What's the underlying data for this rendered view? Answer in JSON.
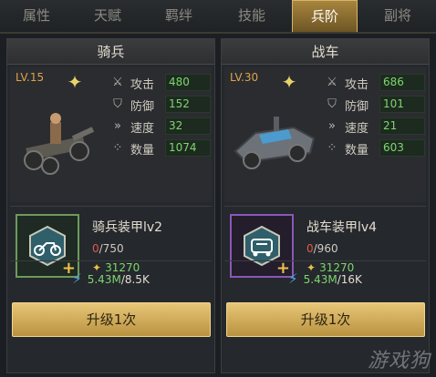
{
  "tabs": [
    "属性",
    "天赋",
    "羁绊",
    "技能",
    "兵阶",
    "副将"
  ],
  "active_tab": "兵阶",
  "panels": [
    {
      "title": "骑兵",
      "level": "LV.15",
      "stats": [
        {
          "label": "攻击",
          "value": "480",
          "icon": "swords-icon"
        },
        {
          "label": "防御",
          "value": "152",
          "icon": "shield-icon"
        },
        {
          "label": "速度",
          "value": "32",
          "icon": "speed-icon"
        },
        {
          "label": "数量",
          "value": "1074",
          "icon": "troops-icon"
        }
      ],
      "armor": {
        "name": "骑兵装甲lv2",
        "current": "0",
        "total": "/750",
        "cost": "31270",
        "frame_color": "green",
        "icon": "motorcycle-icon"
      },
      "power": {
        "have": "5.43M",
        "need": "/8.5K"
      },
      "button": "升级1次"
    },
    {
      "title": "战车",
      "level": "LV.30",
      "stats": [
        {
          "label": "攻击",
          "value": "686",
          "icon": "swords-icon"
        },
        {
          "label": "防御",
          "value": "101",
          "icon": "shield-icon"
        },
        {
          "label": "速度",
          "value": "21",
          "icon": "speed-icon"
        },
        {
          "label": "数量",
          "value": "603",
          "icon": "troops-icon"
        }
      ],
      "armor": {
        "name": "战车装甲lv4",
        "current": "0",
        "total": "/960",
        "cost": "31270",
        "frame_color": "purple",
        "icon": "car-icon"
      },
      "power": {
        "have": "5.43M",
        "need": "/16K"
      },
      "button": "升级1次"
    }
  ],
  "watermark": "游戏狗",
  "colors": {
    "accent": "#c9a24e",
    "value_green": "#7ed66f",
    "level_orange": "#e0a34a",
    "deficit_red": "#e05a4a"
  }
}
